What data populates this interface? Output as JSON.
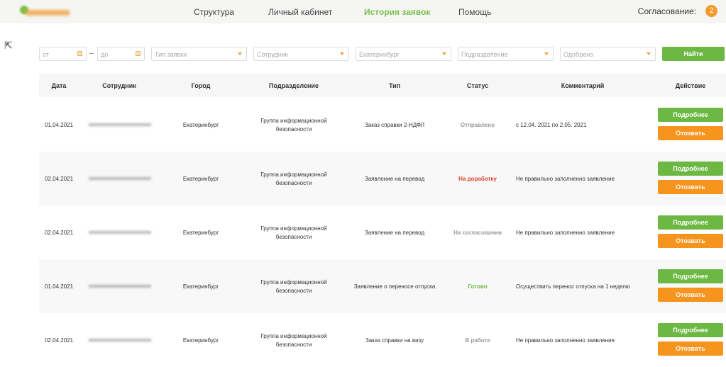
{
  "header": {
    "nav": [
      "Структура",
      "Личный кабинет",
      "История заявок",
      "Помощь"
    ],
    "active_nav": "История заявок",
    "approval_label": "Согласование:",
    "approval_count": "2"
  },
  "filters": {
    "date_from_placeholder": "от",
    "date_to_placeholder": "до",
    "dash": "–",
    "type_placeholder": "Тип заявки",
    "employee_placeholder": "Сотрудник",
    "city_value": "Екатеринбург",
    "department_placeholder": "Подразделение",
    "status_value": "Одобрено",
    "find_label": "Найти"
  },
  "table": {
    "columns": [
      "Дата",
      "Сотрудник",
      "Город",
      "Подразделение",
      "Тип",
      "Статус",
      "Комментарий",
      "Действие"
    ],
    "details_label": "Подробнее",
    "revoke_label": "Отозвать",
    "rows": [
      {
        "date": "01.04.2021",
        "city": "Екатеринбург",
        "dept1": "Группа информационной",
        "dept2": "безопасности",
        "type": "Заказ справки 2-НДФЛ",
        "status": "Отправлено",
        "status_color": "#999999",
        "comment": "с 12.04. 2021  по 2.05. 2021"
      },
      {
        "date": "02.04.2021",
        "city": "Екатеринбург",
        "dept1": "Группа информационной",
        "dept2": "безопасности",
        "type": "Заявление на перевод",
        "status": "На доработку",
        "status_color": "#d9452b",
        "comment": "Не правильно заполненно заявление"
      },
      {
        "date": "02.04.2021",
        "city": "Екатеринбург",
        "dept1": "Группа информационной",
        "dept2": "безопасности",
        "type": "Заявление на перевод",
        "status": "На согласовании",
        "status_color": "#999999",
        "comment": "Не правильно заполненно заявление"
      },
      {
        "date": "01.04.2021",
        "city": "Екатеринбург",
        "dept1": "Группа информационной",
        "dept2": "безопасности",
        "type": "Заявление о переносе отпуска",
        "status": "Готово",
        "status_color": "#6cb843",
        "comment": "Осуществить перенос отпуска на 1 неделю"
      },
      {
        "date": "02.04.2021",
        "city": "Екатеринбург",
        "dept1": "Группа информационной",
        "dept2": "безопасности",
        "type": "Заказ справки на визу",
        "status": "В работе",
        "status_color": "#999999",
        "comment": "Не правильно заполненно заявление"
      }
    ]
  },
  "colors": {
    "accent_green": "#6cb843",
    "accent_orange": "#f7941d"
  }
}
